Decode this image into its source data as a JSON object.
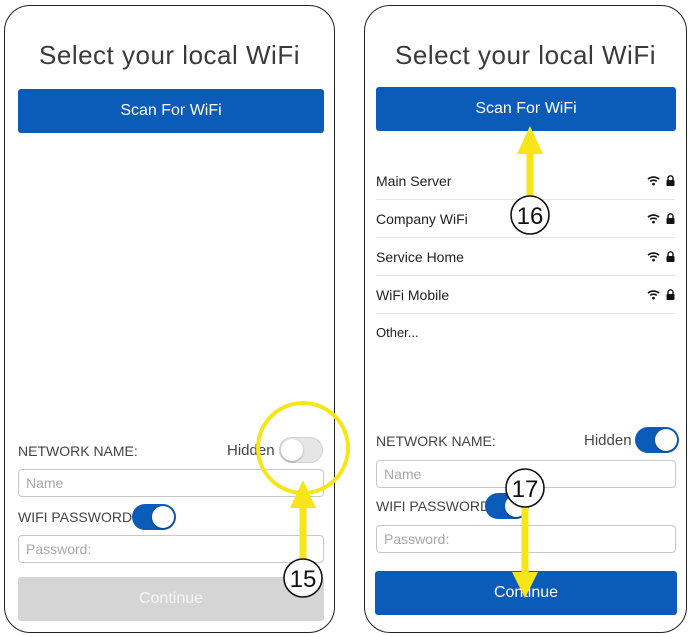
{
  "left_screen": {
    "title": "Select your local WiFi",
    "scan_button_label": "Scan For WiFi",
    "network_name_label": "NETWORK NAME:",
    "hidden_label": "Hidden",
    "hidden_toggle_on": false,
    "name_placeholder": "Name",
    "wifi_password_label": "WIFI PASSWORD",
    "wifi_password_toggle_on": true,
    "password_placeholder": "Password:",
    "continue_label": "Continue",
    "continue_enabled": false
  },
  "right_screen": {
    "title": "Select your local WiFi",
    "scan_button_label": "Scan For WiFi",
    "networks": [
      {
        "name": "Main Server",
        "icons": [
          "wifi-icon",
          "lock-icon"
        ]
      },
      {
        "name": "Company WiFi",
        "icons": [
          "wifi-icon",
          "lock-icon"
        ]
      },
      {
        "name": "Service Home",
        "icons": [
          "wifi-icon",
          "lock-icon"
        ]
      },
      {
        "name": "WiFi Mobile",
        "icons": [
          "wifi-icon",
          "lock-icon"
        ]
      }
    ],
    "other_label": "Other...",
    "network_name_label": "NETWORK NAME:",
    "hidden_label": "Hidden",
    "hidden_toggle_on": true,
    "name_placeholder": "Name",
    "wifi_password_label": "WIFI PASSWORD",
    "wifi_password_toggle_on": true,
    "password_placeholder": "Password:",
    "continue_label": "Continue",
    "continue_enabled": true
  },
  "callouts": {
    "step_15": "15",
    "step_16": "16",
    "step_17": "17"
  },
  "colors": {
    "accent_blue": "#0a5cb8",
    "callout_yellow": "#f7e51a",
    "disabled_gray": "#d5d5d5"
  }
}
